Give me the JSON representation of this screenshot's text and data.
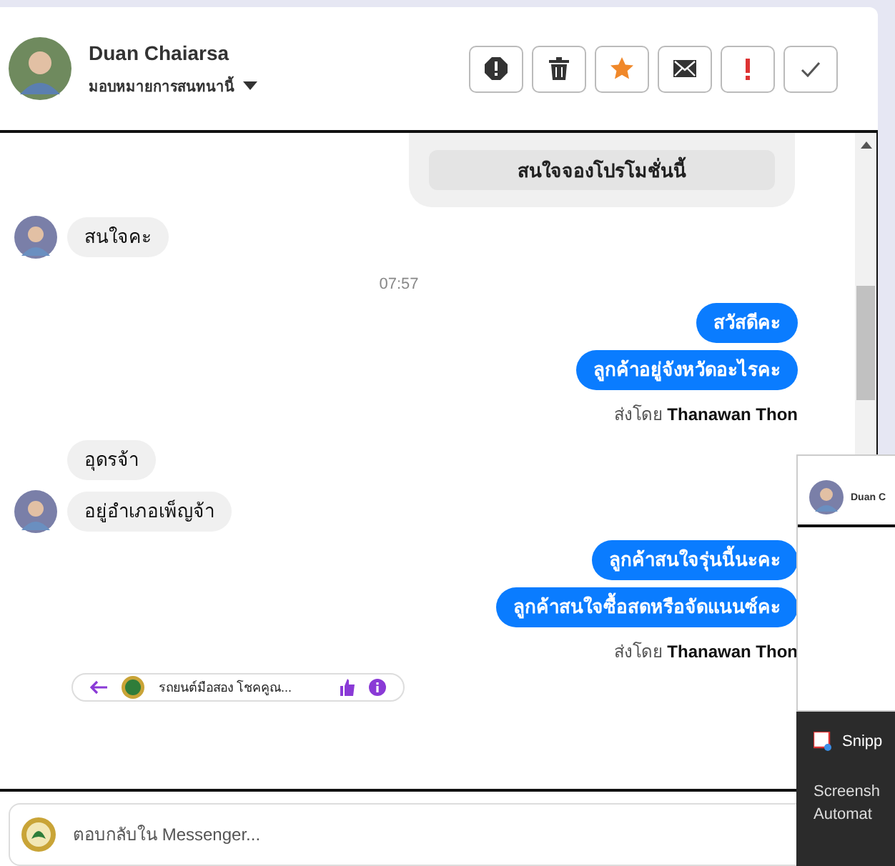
{
  "header": {
    "name": "Duan Chaiarsa",
    "assign_label": "มอบหมายการสนทนานี้"
  },
  "toolbar": [
    {
      "kind": "spam"
    },
    {
      "kind": "delete"
    },
    {
      "kind": "star"
    },
    {
      "kind": "mail"
    },
    {
      "kind": "important"
    },
    {
      "kind": "done"
    }
  ],
  "messages": [
    {
      "kind": "card",
      "button": "สนใจจองโปรโมชั่นนี้"
    },
    {
      "kind": "in",
      "text": "สนใจคะ",
      "avatar": true
    },
    {
      "kind": "time",
      "text": "07:57"
    },
    {
      "kind": "out",
      "text": "สวัสดีคะ"
    },
    {
      "kind": "out",
      "text": "ลูกค้าอยู่จังหวัดอะไรคะ"
    },
    {
      "kind": "sent_by",
      "text": "ส่งโดย **Thanawan Thon**"
    },
    {
      "kind": "in",
      "text": "อุดรจ้า",
      "avatar": false
    },
    {
      "kind": "in",
      "text": "อยู่อำเภอเพ็ญจ้า",
      "avatar": true
    },
    {
      "kind": "out",
      "text": "ลูกค้าสนใจรุ่นนี้นะคะ"
    },
    {
      "kind": "out",
      "text": "ลูกค้าสนใจซื้อสดหรือจัดแนนซ์คะ"
    },
    {
      "kind": "sent_by",
      "text": "ส่งโดย **Thanawan Thon**"
    },
    {
      "kind": "link_preview",
      "text": "รถยนต์มือสอง โชคคูณ..."
    }
  ],
  "composer": {
    "placeholder": "ตอบกลับใน Messenger..."
  },
  "popup_window": {
    "name": "Duan C"
  },
  "notification": {
    "app": "Snipp",
    "lines": [
      "Screensh",
      "Automat"
    ]
  }
}
